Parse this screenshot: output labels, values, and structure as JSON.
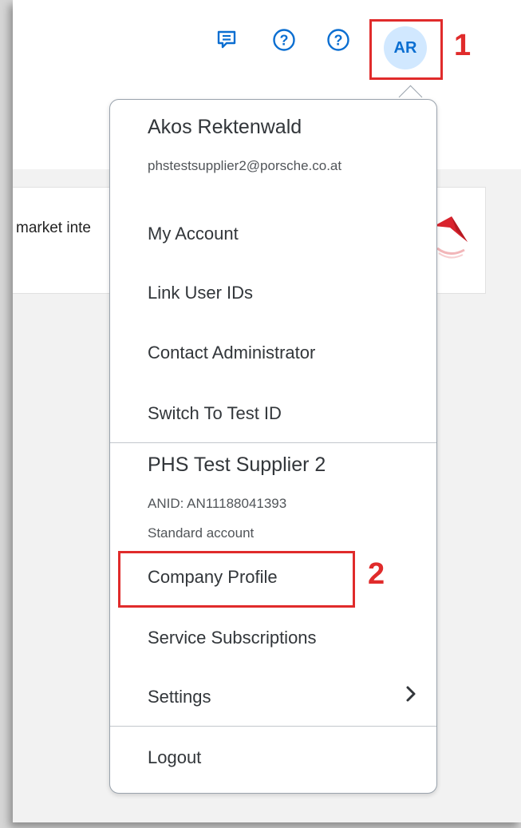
{
  "annotations": {
    "step1": "1",
    "step2": "2"
  },
  "header": {
    "icons": [
      "chat-icon",
      "help-icon",
      "help-icon"
    ],
    "avatar_initials": "AR"
  },
  "banner": {
    "text": "market inte"
  },
  "menu": {
    "user_name": "Akos Rektenwald",
    "user_email": "phstestsupplier2@porsche.co.at",
    "items_user": [
      "My Account",
      "Link User IDs",
      "Contact Administrator",
      "Switch To Test ID"
    ],
    "company_name": "PHS Test Supplier 2",
    "anid": "ANID: AN11188041393",
    "account_type": "Standard account",
    "items_company": [
      "Company Profile",
      "Service Subscriptions",
      "Settings"
    ],
    "logout": "Logout"
  },
  "colors": {
    "accent": "#0a6ed1",
    "annotation_red": "#e02b2b",
    "avatar_bg": "#d1e8ff"
  }
}
